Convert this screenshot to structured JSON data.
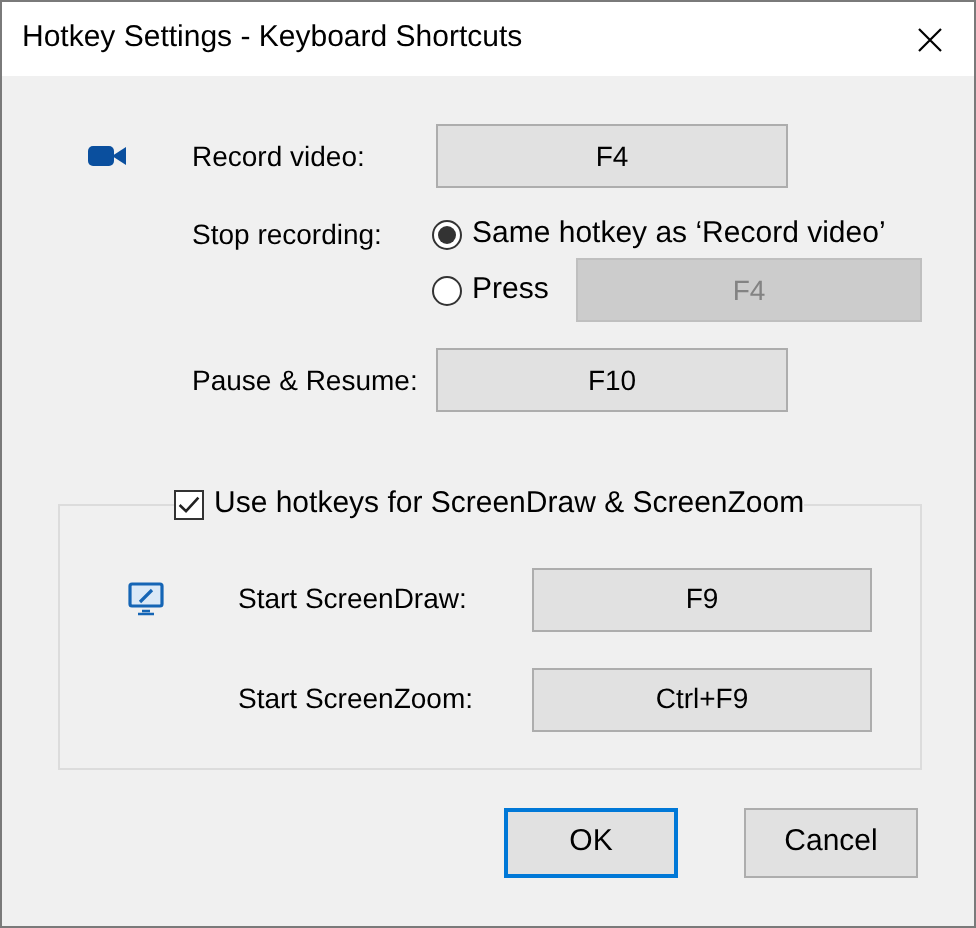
{
  "window": {
    "title": "Hotkey Settings - Keyboard Shortcuts"
  },
  "recording": {
    "record": {
      "label": "Record video:",
      "hotkey": "F4"
    },
    "stop": {
      "label": "Stop recording:",
      "options": [
        {
          "label": "Same hotkey as ‘Record video’",
          "selected": true
        },
        {
          "label": "Press",
          "selected": false,
          "hotkey": "F4"
        }
      ]
    },
    "pause": {
      "label": "Pause & Resume:",
      "hotkey": "F10"
    }
  },
  "screen_tools": {
    "checkbox": {
      "label": "Use hotkeys for ScreenDraw & ScreenZoom",
      "checked": true
    },
    "rows": [
      {
        "label": "Start ScreenDraw:",
        "hotkey": "F9"
      },
      {
        "label": "Start ScreenZoom:",
        "hotkey": "Ctrl+F9"
      }
    ]
  },
  "buttons": [
    {
      "label": "OK",
      "default": true
    },
    {
      "label": "Cancel",
      "default": false
    }
  ]
}
